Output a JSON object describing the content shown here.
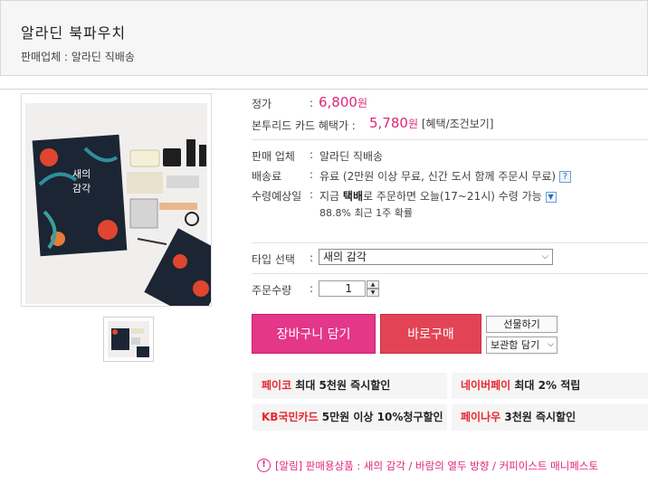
{
  "product": {
    "title": "알라딘 북파우치",
    "seller_line": "판매업체 : 알라딘 직배송"
  },
  "price": {
    "list_label": "정가",
    "list_price": "6,800",
    "won": "원",
    "card_label": "본투리드 카드 혜택가 :",
    "card_price": "5,780",
    "card_link": "[혜택/조건보기]"
  },
  "shipping": {
    "seller_label": "판매 업체",
    "seller_value": "알라딘 직배송",
    "fee_label": "배송료",
    "fee_value": "유료 (2만원 이상 무료, 신간 도서 함께 주문시 무료)",
    "eta_label": "수령예상일",
    "eta_prefix": "지금",
    "eta_bold": "택배",
    "eta_suffix": "로 주문하면 오늘(17~21시) 수령 가능",
    "eta_rate": "88.8% 최근 1주 확률"
  },
  "options": {
    "type_label": "타입 선택",
    "type_value": "새의 감각",
    "qty_label": "주문수량",
    "qty_value": "1"
  },
  "actions": {
    "cart": "장바구니 담기",
    "buy": "바로구매",
    "gift": "선물하기",
    "save": "보관함 담기"
  },
  "promos": [
    {
      "brand": "페이코",
      "text": " 최대 5천원 즉시할인"
    },
    {
      "brand": "네이버페이",
      "text": " 최대 2% 적립"
    },
    {
      "brand": "KB국민카드",
      "text": " 5만원 이상 10%청구할인"
    },
    {
      "brand": "페이나우",
      "text": " 3천원 즉시할인"
    }
  ],
  "notice": "[알림] 판매용상품 : 새의 감각 / 바람의 열두 방향 / 커피이스트 매니페스토",
  "icons": {
    "help": "?",
    "down": "▼",
    "alert": "!"
  },
  "colors": {
    "accent": "#e0257a",
    "cart": "#e4378a",
    "buy": "#e24455",
    "promo_brand": "#e8262d"
  }
}
